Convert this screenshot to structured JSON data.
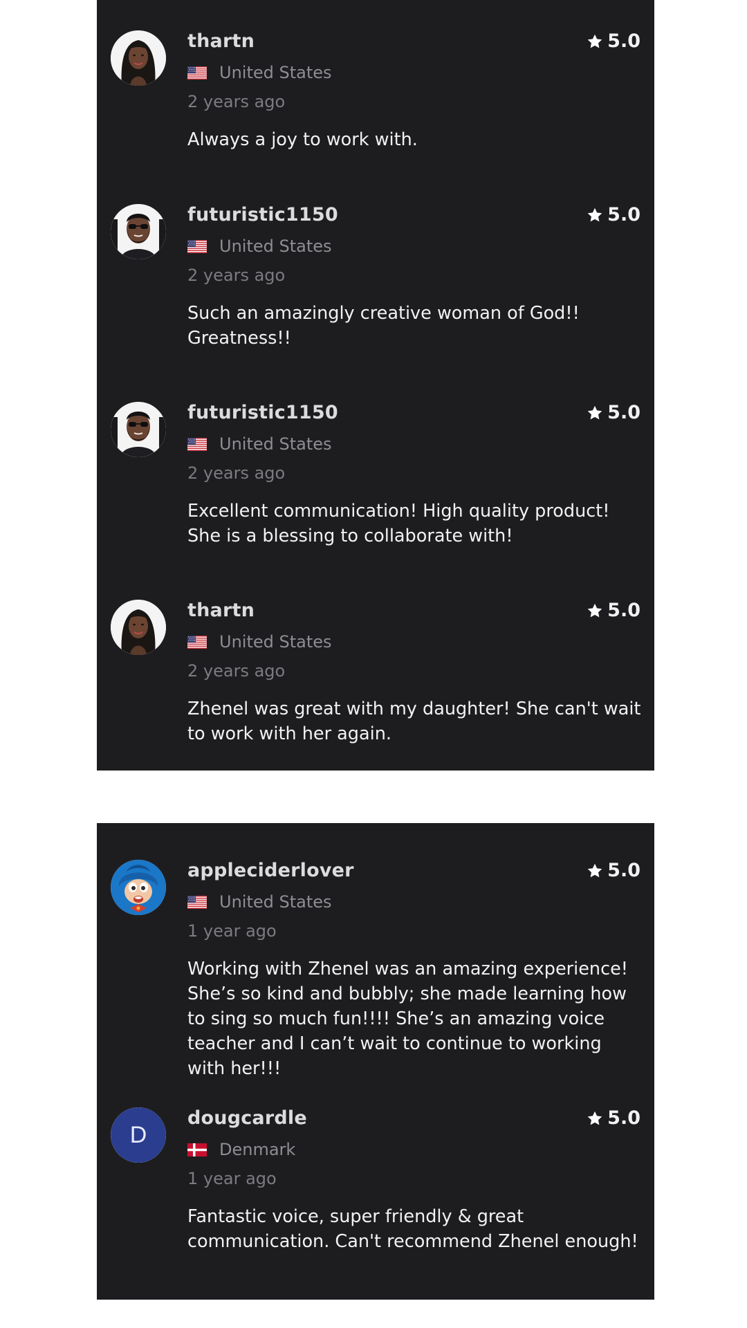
{
  "star_color": "#ffffff",
  "panels": [
    {
      "reviews": [
        {
          "username": "thartn",
          "rating": "5.0",
          "country": "United States",
          "country_flag": "us-flag-icon",
          "time_ago": "2 years ago",
          "comment": "Always a joy to work with.",
          "avatar": "woman-avatar"
        },
        {
          "username": "futuristic1150",
          "rating": "5.0",
          "country": "United States",
          "country_flag": "us-flag-icon",
          "time_ago": "2 years ago",
          "comment": "Such an amazingly creative woman of God!! Greatness!!",
          "avatar": "man-sunglasses-avatar"
        },
        {
          "username": "futuristic1150",
          "rating": "5.0",
          "country": "United States",
          "country_flag": "us-flag-icon",
          "time_ago": "2 years ago",
          "comment": "Excellent communication!  High quality product! She is a blessing to collaborate with!",
          "avatar": "man-sunglasses-avatar"
        },
        {
          "username": "thartn",
          "rating": "5.0",
          "country": "United States",
          "country_flag": "us-flag-icon",
          "time_ago": "2 years ago",
          "comment": "Zhenel was great with my daughter! She can't wait to work with her again.",
          "avatar": "woman-avatar"
        }
      ]
    },
    {
      "reviews": [
        {
          "username": "appleciderlover",
          "rating": "5.0",
          "country": "United States",
          "country_flag": "us-flag-icon",
          "time_ago": "1 year ago",
          "comment": "Working with Zhenel was an amazing experience! She’s so kind and bubbly; she made learning how to sing so much fun!!!! She’s an amazing voice teacher and I can’t wait to continue to working with her!!!",
          "avatar": "cartoon-avatar"
        },
        {
          "username": "dougcardle",
          "rating": "5.0",
          "country": "Denmark",
          "country_flag": "denmark-flag-icon",
          "time_ago": "1 year ago",
          "comment": "Fantastic voice, super friendly & great communication. Can't recommend Zhenel enough!",
          "avatar": "letter-avatar",
          "avatar_letter": "D"
        }
      ]
    }
  ]
}
